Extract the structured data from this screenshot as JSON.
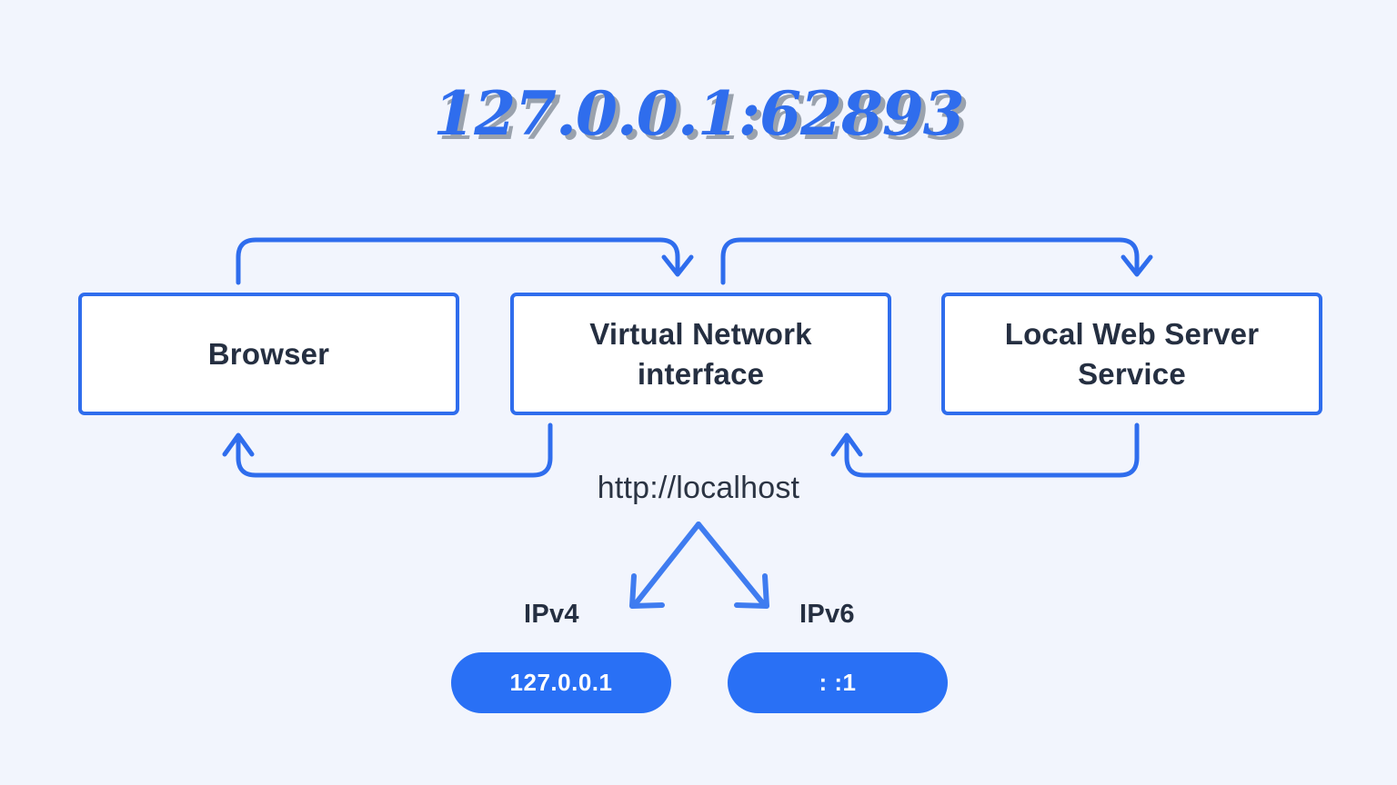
{
  "title": "127.0.0.1:62893",
  "colors": {
    "background": "#f2f5fd",
    "accent_blue": "#2f6ded",
    "pill_blue": "#2970f5",
    "arrow_blue": "#2f6ded",
    "text_navy": "#252f41",
    "title_shadow": "#9aa2ad",
    "box_fill": "#ffffff"
  },
  "nodes": [
    {
      "id": "browser",
      "label": "Browser"
    },
    {
      "id": "virtual-network-interface",
      "label": "Virtual Network\ninterface",
      "line1": "Virtual Network",
      "line2": "interface"
    },
    {
      "id": "local-web-server-service",
      "label": "Local Web Server\nService",
      "line1": "Local Web Server",
      "line2": "Service"
    }
  ],
  "captions": {
    "localhost": "http://localhost",
    "ipv4": "IPv4",
    "ipv6": "IPv6"
  },
  "pills": [
    {
      "id": "ipv4-address",
      "label": "127.0.0.1"
    },
    {
      "id": "ipv6-address",
      "label": ": :1"
    }
  ],
  "connectors": [
    {
      "id": "browser-to-vni",
      "from": "browser",
      "to": "virtual-network-interface",
      "direction": "top-loop-right",
      "arrowhead": "down"
    },
    {
      "id": "vni-to-server",
      "from": "virtual-network-interface",
      "to": "local-web-server-service",
      "direction": "top-loop-right",
      "arrowhead": "down"
    },
    {
      "id": "vni-to-browser",
      "from": "virtual-network-interface",
      "to": "browser",
      "direction": "bottom-loop-left",
      "arrowhead": "up"
    },
    {
      "id": "server-to-vni",
      "from": "local-web-server-service",
      "to": "virtual-network-interface",
      "direction": "bottom-loop-left",
      "arrowhead": "up"
    },
    {
      "id": "localhost-to-ipv4",
      "from": "localhost",
      "to": "ipv4-address",
      "direction": "diagonal-down-left",
      "arrowhead": "down-left"
    },
    {
      "id": "localhost-to-ipv6",
      "from": "localhost",
      "to": "ipv6-address",
      "direction": "diagonal-down-right",
      "arrowhead": "down-right"
    }
  ]
}
